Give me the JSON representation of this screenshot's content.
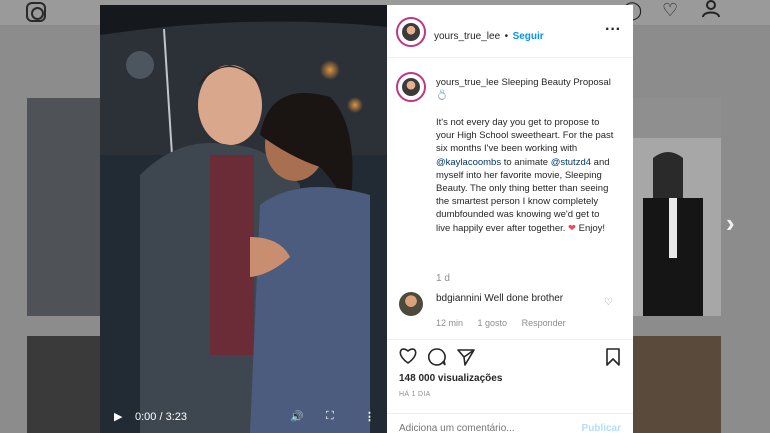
{
  "post": {
    "username": "yours_true_lee",
    "dot": "•",
    "follow_label": "Seguir",
    "more_label": "•••",
    "caption_title": "Sleeping Beauty Proposal 💍",
    "caption_text_1": "It's not every day you get to propose to your High School sweetheart. For the past six months I've been working with ",
    "mention_1": "@kaylacoombs",
    "caption_text_2": " to animate ",
    "mention_2": "@stutzd4",
    "caption_text_3": " and myself into her favorite movie, Sleeping Beauty. The only thing better than seeing the smartest person I know completely dumbfounded was knowing we'd get to live happily ever after together. ",
    "heart_emoji": "❤",
    "caption_text_4": " Enjoy!",
    "time": "1 d"
  },
  "comment": {
    "username": "bdgiannini",
    "text": "Well done brother",
    "time": "12 min",
    "likes": "1 gosto",
    "reply": "Responder"
  },
  "stats": {
    "views": "148 000 visualizações",
    "ago": "HÁ 1 DIA"
  },
  "add_comment": {
    "placeholder": "Adiciona um comentário...",
    "publish": "Publicar"
  },
  "video": {
    "time": "0:00 / 3:23"
  },
  "icons": {
    "like": "heart-icon",
    "comment": "comment-icon",
    "share": "share-icon",
    "save": "bookmark-icon"
  }
}
